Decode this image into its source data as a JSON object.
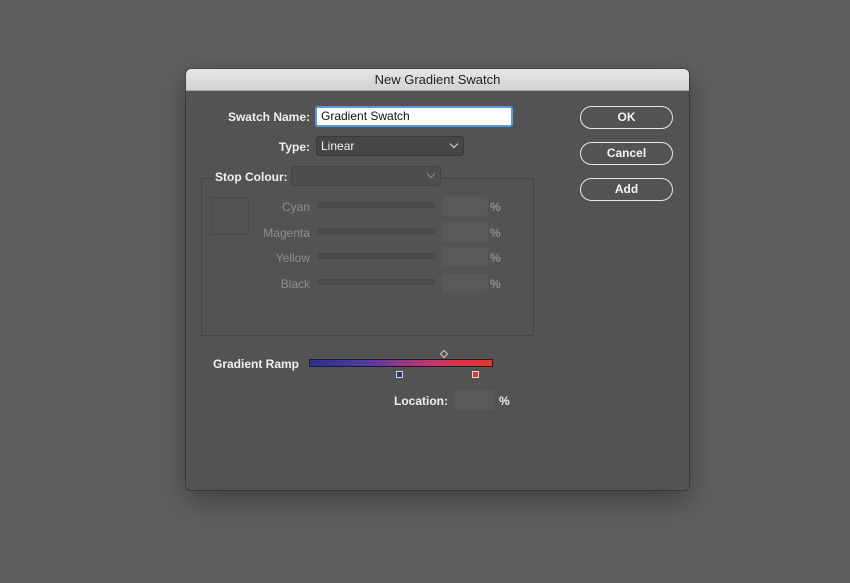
{
  "dialog": {
    "title": "New Gradient Swatch",
    "swatch_name_label": "Swatch Name:",
    "swatch_name_value": "Gradient Swatch",
    "type_label": "Type:",
    "type_value": "Linear",
    "stop_colour_label": "Stop Colour:",
    "stop_colour_value": "",
    "channels": [
      {
        "label": "Cyan",
        "value": "",
        "unit": "%"
      },
      {
        "label": "Magenta",
        "value": "",
        "unit": "%"
      },
      {
        "label": "Yellow",
        "value": "",
        "unit": "%"
      },
      {
        "label": "Black",
        "value": "",
        "unit": "%"
      }
    ],
    "gradient_ramp_label": "Gradient Ramp",
    "ramp_colors": {
      "start": "#27338f",
      "end": "#e2382a"
    },
    "location_label": "Location:",
    "location_value": "",
    "location_unit": "%"
  },
  "buttons": {
    "ok": "OK",
    "cancel": "Cancel",
    "add": "Add"
  }
}
